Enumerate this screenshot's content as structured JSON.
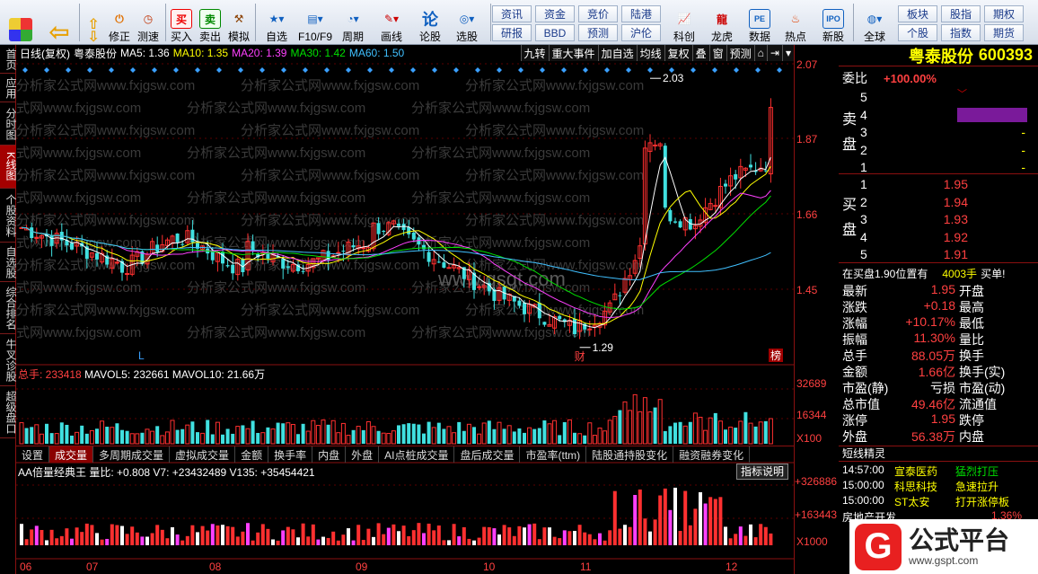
{
  "toolbar": {
    "items": [
      "修正",
      "测速",
      "买入",
      "卖出",
      "模拟",
      "自选",
      "F10/F9",
      "周期",
      "画线",
      "论股",
      "选股",
      "科创",
      "龙虎",
      "数据",
      "热点",
      "新股",
      "全球"
    ],
    "right_top": [
      "资讯",
      "资金",
      "竞价",
      "陆港"
    ],
    "right_bottom": [
      "研报",
      "BBD",
      "预测",
      "沪伦"
    ],
    "far_top": [
      "板块",
      "股指",
      "期权"
    ],
    "far_bottom": [
      "个股",
      "指数",
      "期货"
    ]
  },
  "sidebar": [
    "首页",
    "应用",
    "分时图",
    "K线图",
    "个股资料",
    "自选股",
    "综合排名",
    "牛叉诊股",
    "超级盘口"
  ],
  "chart": {
    "header": {
      "title": "日线(复权)",
      "stock": "粤泰股份",
      "ma5": "MA5: 1.36",
      "ma10": "MA10: 1.35",
      "ma20": "MA20: 1.39",
      "ma30": "MA30: 1.42",
      "ma60": "MA60: 1.50"
    },
    "buttons": [
      "九转",
      "重大事件",
      "加自选",
      "均线",
      "复权",
      "叠",
      "窗",
      "预测"
    ],
    "high_label": "2.03",
    "low_label": "1.29",
    "marker_cai": "财",
    "marker_bang": "榜",
    "marker_l": "L",
    "price_axis": [
      "2.07",
      "1.87",
      "1.66",
      "1.45"
    ],
    "vol_header": {
      "total": "总手: 233418",
      "mavol5": "MAVOL5: 232661",
      "mavol10": "MAVOL10: 21.66万"
    },
    "vol_axis": [
      "32689",
      "16344",
      "X100"
    ],
    "tabs": [
      "设置",
      "成交量",
      "多周期成交量",
      "虚拟成交量",
      "金额",
      "换手率",
      "内盘",
      "外盘",
      "AI点桩成交量",
      "盘后成交量",
      "市盈率(ttm)",
      "陆股通持股变化",
      "融资融券变化"
    ],
    "ind_header": {
      "name": "AA倍量经典王",
      "ratio": "量比: +0.808",
      "v7": "V7: +23432489",
      "v135": "V135: +35454421"
    },
    "ind_btn": "指标说明",
    "ind_axis": [
      "+326886",
      "+163443",
      "X1000"
    ],
    "months": [
      "06",
      "07",
      "08",
      "09",
      "10",
      "11",
      "12"
    ],
    "watermark": "分析家公式网www.fxjgsw.com",
    "watermark2": "www.gsgt.com"
  },
  "quote": {
    "name": "粤泰股份",
    "code": "600393",
    "weibi_label": "委比",
    "weibi": "+100.00%",
    "sell_label": "卖盘",
    "buy_label": "买盘",
    "sells": [
      {
        "n": "5",
        "p": "",
        "v": ""
      },
      {
        "n": "4",
        "p": "",
        "v": "-"
      },
      {
        "n": "3",
        "p": "",
        "v": "-"
      },
      {
        "n": "2",
        "p": "",
        "v": "-"
      },
      {
        "n": "1",
        "p": "",
        "v": "-"
      }
    ],
    "buys": [
      {
        "n": "1",
        "p": "1.95",
        "v": ""
      },
      {
        "n": "2",
        "p": "1.94",
        "v": ""
      },
      {
        "n": "3",
        "p": "1.93",
        "v": ""
      },
      {
        "n": "4",
        "p": "1.92",
        "v": ""
      },
      {
        "n": "5",
        "p": "1.91",
        "v": ""
      }
    ],
    "pos_text": "在买盘1.90位置有",
    "pos_vol": "4003手",
    "pos_act": "买单!",
    "stats": [
      [
        "最新",
        "1.95",
        "开盘",
        ""
      ],
      [
        "涨跌",
        "+0.18",
        "最高",
        ""
      ],
      [
        "涨幅",
        "+10.17%",
        "最低",
        ""
      ],
      [
        "振幅",
        "11.30%",
        "量比",
        ""
      ],
      [
        "总手",
        "88.05万",
        "换手",
        ""
      ],
      [
        "金额",
        "1.66亿",
        "换手(实)",
        ""
      ],
      [
        "市盈(静)",
        "亏损",
        "市盈(动)",
        ""
      ],
      [
        "总市值",
        "49.46亿",
        "流通值",
        ""
      ],
      [
        "涨停",
        "1.95",
        "跌停",
        ""
      ],
      [
        "外盘",
        "56.38万",
        "内盘",
        ""
      ]
    ],
    "jingxuan": "短线精灵",
    "news": [
      [
        "14:57:00",
        "宣泰医药",
        "猛烈打压"
      ],
      [
        "15:00:00",
        "科思科技",
        "急速拉升"
      ],
      [
        "15:00:00",
        "ST太安",
        "打开涨停板"
      ]
    ],
    "extra": "房地产开发",
    "extra_val": "1.36%"
  },
  "logo": {
    "text": "公式平台",
    "url": "www.gspt.com"
  }
}
